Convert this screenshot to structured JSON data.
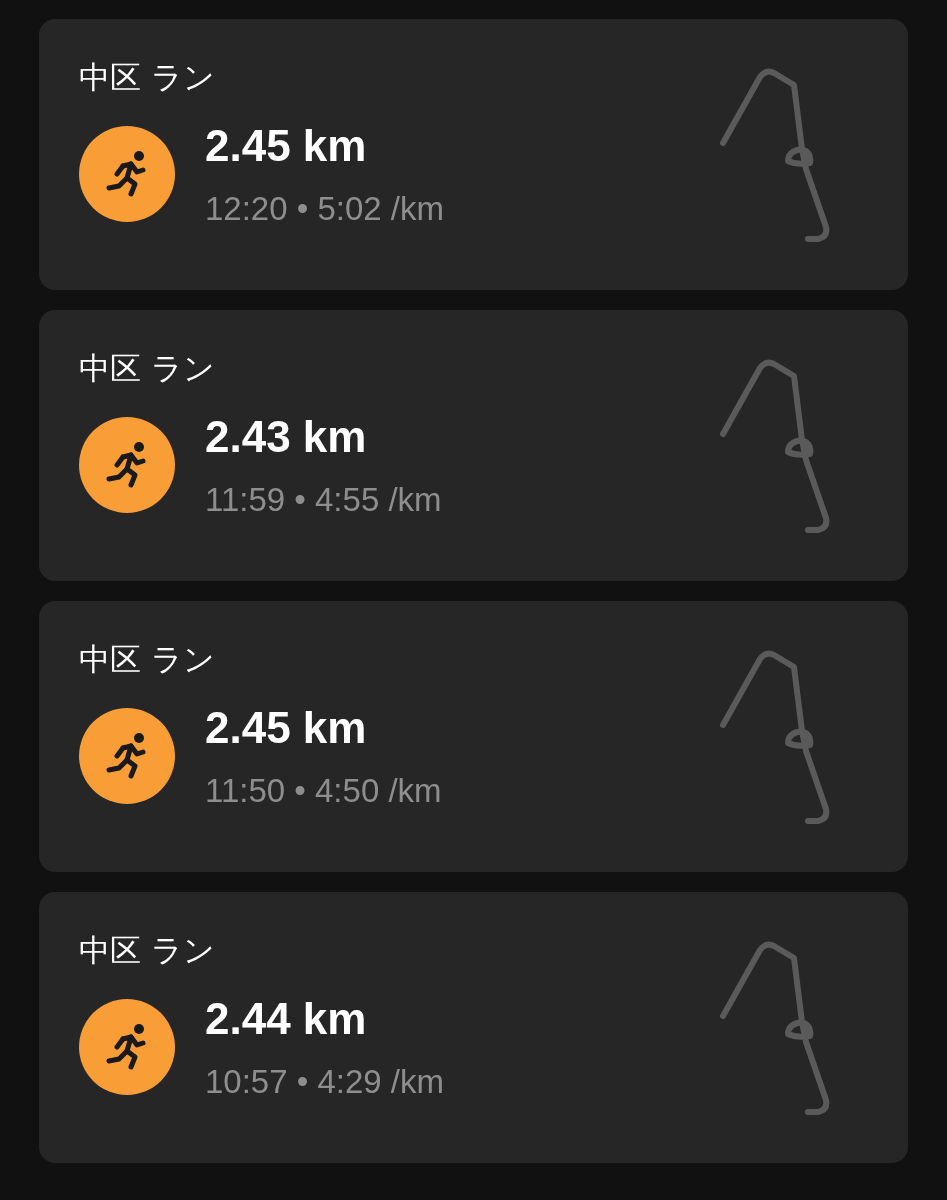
{
  "activities": [
    {
      "title": "中区 ラン",
      "distance": "2.45 km",
      "detail": "12:20 • 5:02 /km"
    },
    {
      "title": "中区 ラン",
      "distance": "2.43 km",
      "detail": "11:59 • 4:55 /km"
    },
    {
      "title": "中区 ラン",
      "distance": "2.45 km",
      "detail": "11:50 • 4:50 /km"
    },
    {
      "title": "中区 ラン",
      "distance": "2.44 km",
      "detail": "10:57 • 4:29 /km"
    }
  ]
}
